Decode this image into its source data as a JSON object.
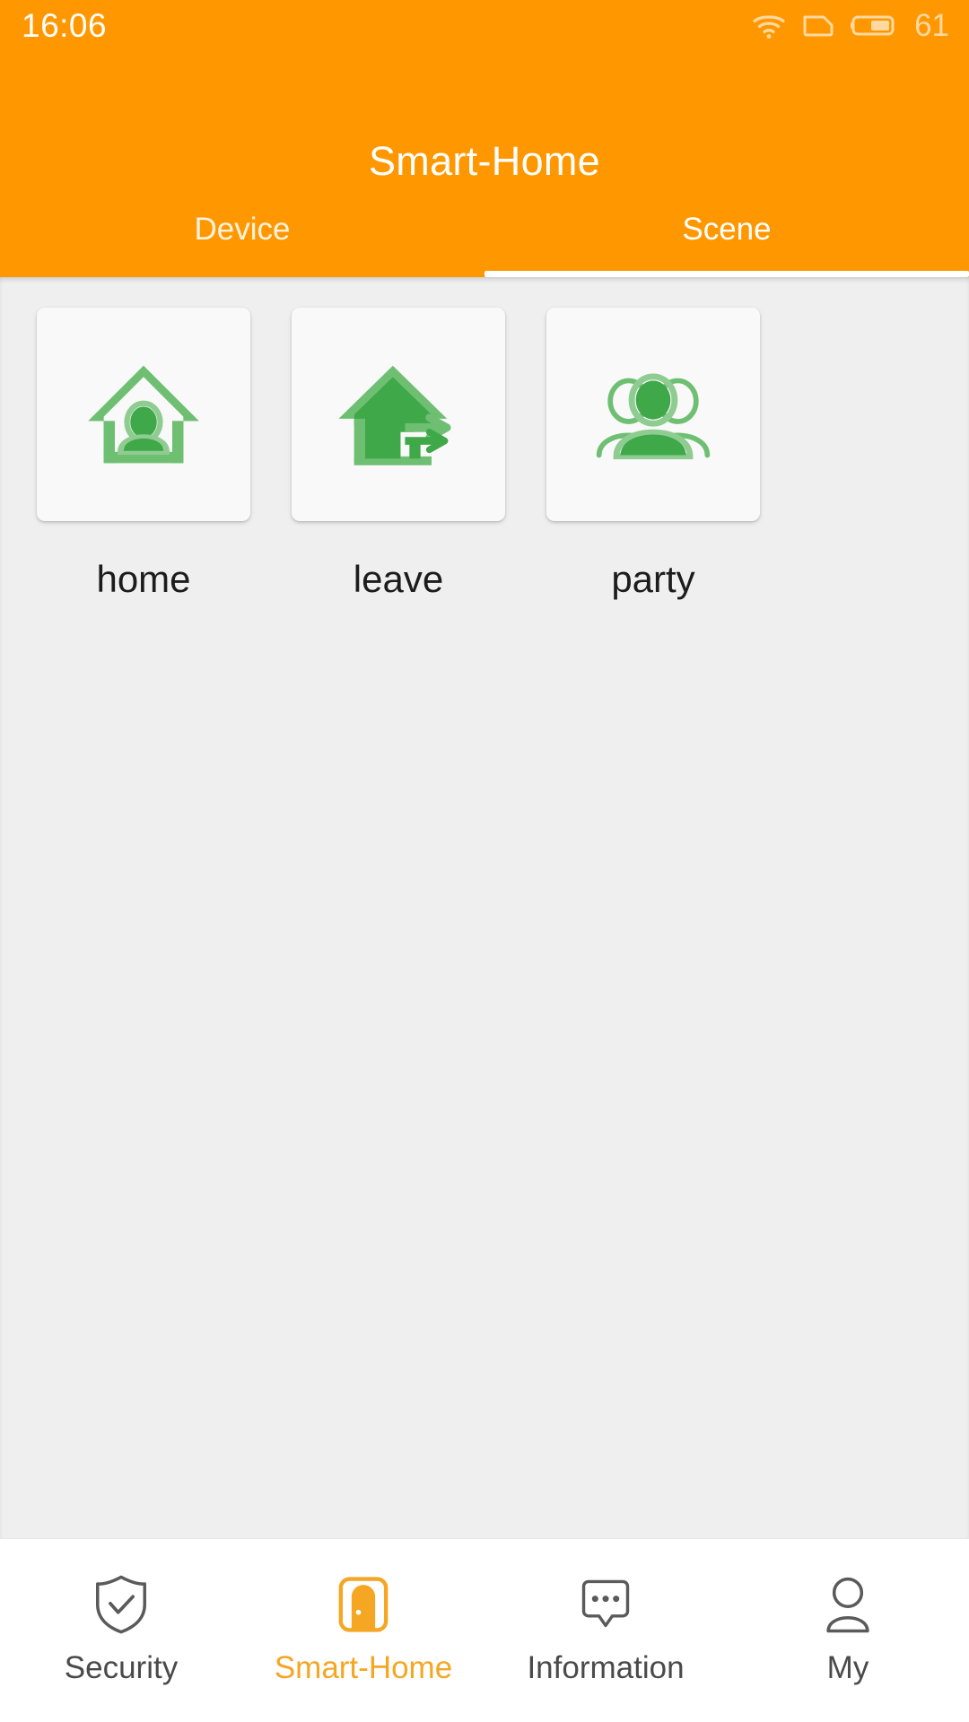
{
  "status_bar": {
    "time": "16:06",
    "battery_percent": "61",
    "icons": [
      "wifi-icon",
      "sim-card-icon",
      "battery-icon"
    ]
  },
  "header": {
    "title": "Smart-Home",
    "background_color": "#FF9800",
    "tabs": [
      {
        "label": "Device",
        "active": false
      },
      {
        "label": "Scene",
        "active": true
      }
    ]
  },
  "main": {
    "background_color": "#EFEFEF",
    "scenes": [
      {
        "label": "home",
        "icon": "house-with-person-icon"
      },
      {
        "label": "leave",
        "icon": "house-with-exit-arrow-icon"
      },
      {
        "label": "party",
        "icon": "group-of-people-icon"
      }
    ],
    "scene_icon_color": "#3FA848",
    "scene_icon_outline_color": "#6FBF73"
  },
  "bottom_nav": {
    "active_color": "#F5A623",
    "inactive_color": "#4A4A4A",
    "items": [
      {
        "label": "Security",
        "icon": "shield-check-icon",
        "active": false
      },
      {
        "label": "Smart-Home",
        "icon": "door-icon",
        "active": true
      },
      {
        "label": "Information",
        "icon": "chat-bubble-icon",
        "active": false
      },
      {
        "label": "My",
        "icon": "user-icon",
        "active": false
      }
    ]
  }
}
